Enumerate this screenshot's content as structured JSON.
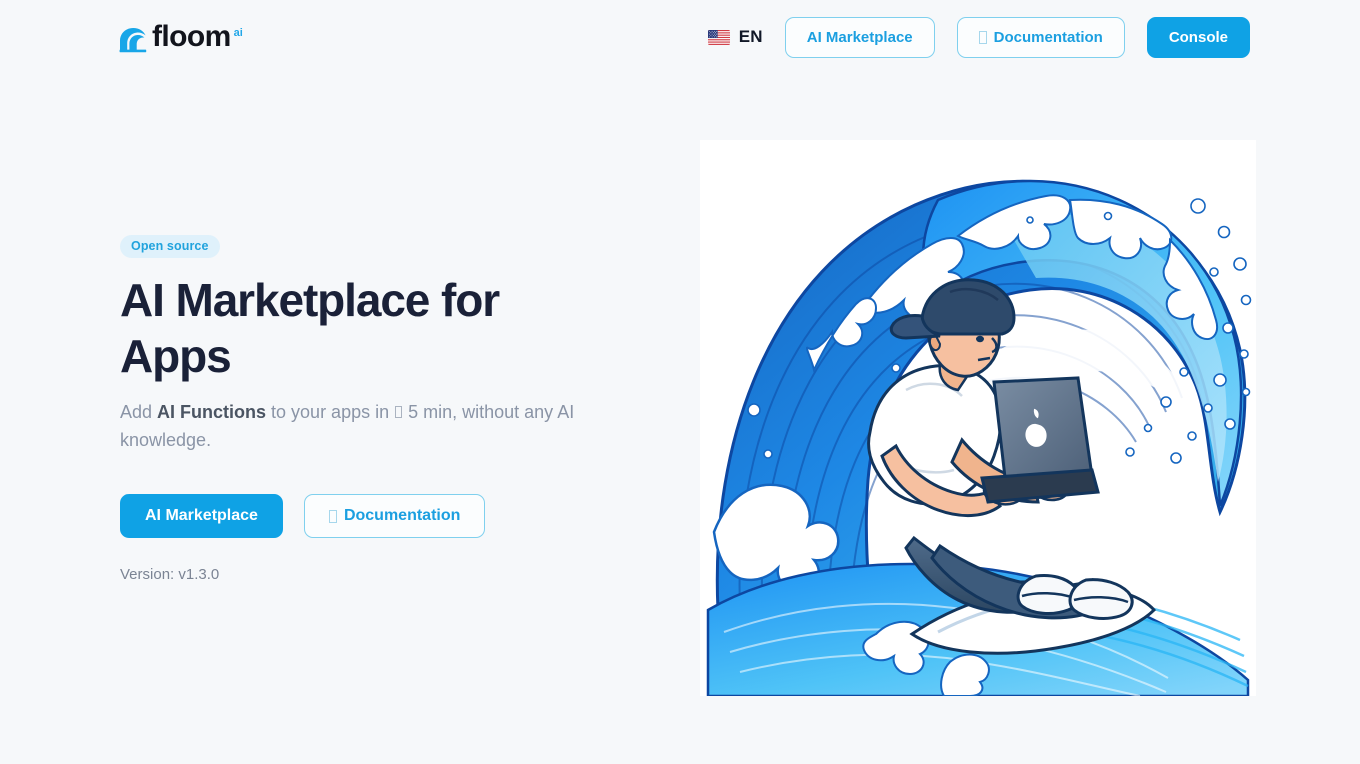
{
  "colors": {
    "page_bg": "#f6f8fa",
    "accent": "#0fa2e5",
    "accent_light": "#7fd0ee",
    "badge_bg": "#dff1fb",
    "badge_text": "#22a3dd",
    "heading": "#1a2138",
    "muted": "#8a94a6"
  },
  "header": {
    "brand": {
      "icon": "wave-logo-icon",
      "word": "floom",
      "superscript": "ai"
    },
    "language": {
      "icon": "us-flag-icon",
      "label": "EN"
    },
    "nav_buttons": [
      {
        "label": "AI Marketplace",
        "style": "outline",
        "icon": null,
        "name": "nav-ai-marketplace-button"
      },
      {
        "label": "Documentation",
        "style": "outline",
        "icon": "missing-glyph-icon",
        "name": "nav-documentation-button"
      },
      {
        "label": "Console",
        "style": "primary",
        "icon": null,
        "name": "nav-console-button"
      }
    ]
  },
  "hero": {
    "badge": "Open source",
    "headline": "AI Marketplace for Apps",
    "subhead": {
      "prefix": "Add ",
      "bold": "AI Functions",
      "middle": " to your apps in ",
      "suffix": " 5 min, without any AI knowledge."
    },
    "cta_buttons": [
      {
        "label": "AI Marketplace",
        "style": "primary",
        "icon": null,
        "name": "cta-ai-marketplace-button"
      },
      {
        "label": "Documentation",
        "style": "outline",
        "icon": "missing-glyph-icon",
        "name": "cta-documentation-button"
      }
    ],
    "version": "Version: v1.3.0",
    "illustration": {
      "name": "surfer-with-laptop-illustration",
      "alt": "Illustration of a surfer riding inside a large blue wave barrel while typing on a laptop"
    }
  }
}
